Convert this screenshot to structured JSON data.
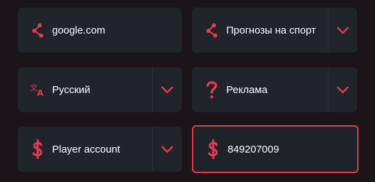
{
  "colors": {
    "accent": "#e83c4f",
    "field_bg": "#20242b",
    "page_bg": "#1b1419"
  },
  "fields": {
    "site": {
      "value": "google.com",
      "icon": "share-node-icon"
    },
    "category": {
      "value": "Прогнозы на спорт",
      "icon": "share-node-icon"
    },
    "language": {
      "value": "Русский",
      "icon": "translate-icon"
    },
    "ad_type": {
      "value": "Реклама",
      "icon": "question-icon"
    },
    "currency_account": {
      "value": "Player account",
      "icon": "dollar-icon"
    },
    "account_id": {
      "value": "849207009",
      "icon": "dollar-icon"
    }
  }
}
